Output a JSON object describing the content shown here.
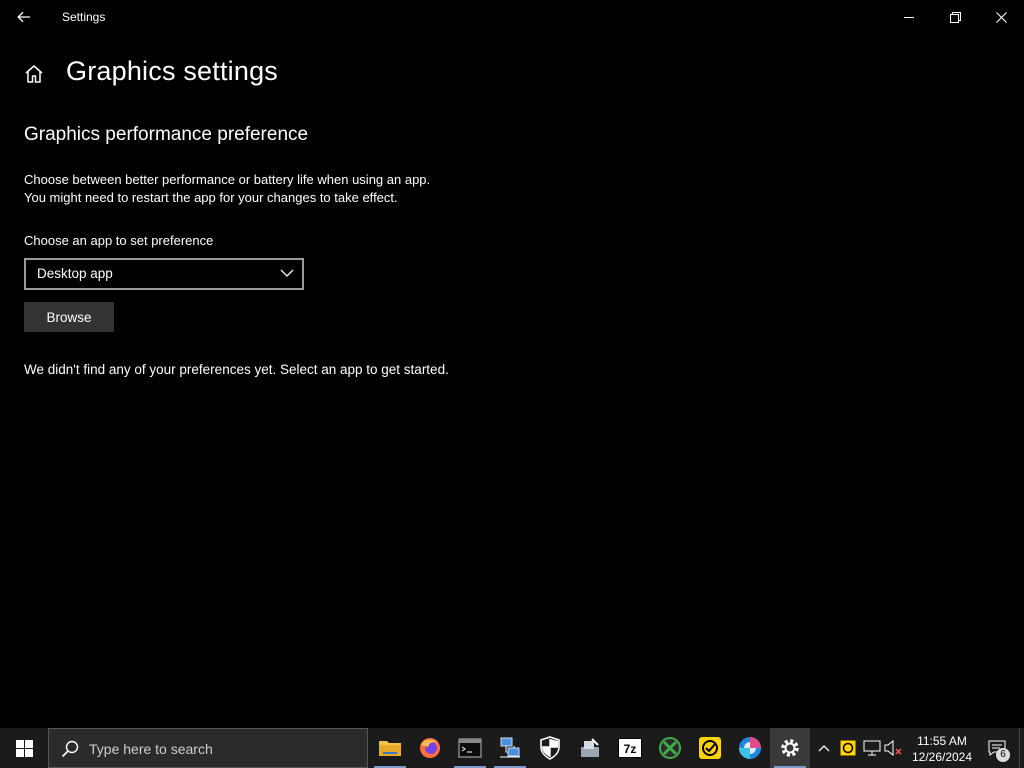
{
  "window": {
    "title": "Settings"
  },
  "header": {
    "page_title": "Graphics settings"
  },
  "main": {
    "section_title": "Graphics performance preference",
    "description_line1": "Choose between better performance or battery life when using an app.",
    "description_line2": "You might need to restart the app for your changes to take effect.",
    "choose_label": "Choose an app to set preference",
    "app_type_dropdown": {
      "selected": "Desktop app"
    },
    "browse_label": "Browse",
    "empty_message": "We didn't find any of your preferences yet. Select an app to get started."
  },
  "taskbar": {
    "search_placeholder": "Type here to search",
    "pinned_apps": [
      "file-explorer-icon",
      "firefox-icon",
      "terminal-icon",
      "network-icon",
      "security-shield-icon",
      "installer-icon",
      "7zip-icon",
      "xbox-icon",
      "norton-icon",
      "photos-icon",
      "settings-gear-icon"
    ],
    "tray": {
      "time": "11:55 AM",
      "date": "12/26/2024",
      "notification_count": "6"
    }
  },
  "colors": {
    "background": "#000000",
    "taskbar": "#1b1b1b",
    "button": "#333333",
    "dropdown_border": "#9a9a9a"
  }
}
